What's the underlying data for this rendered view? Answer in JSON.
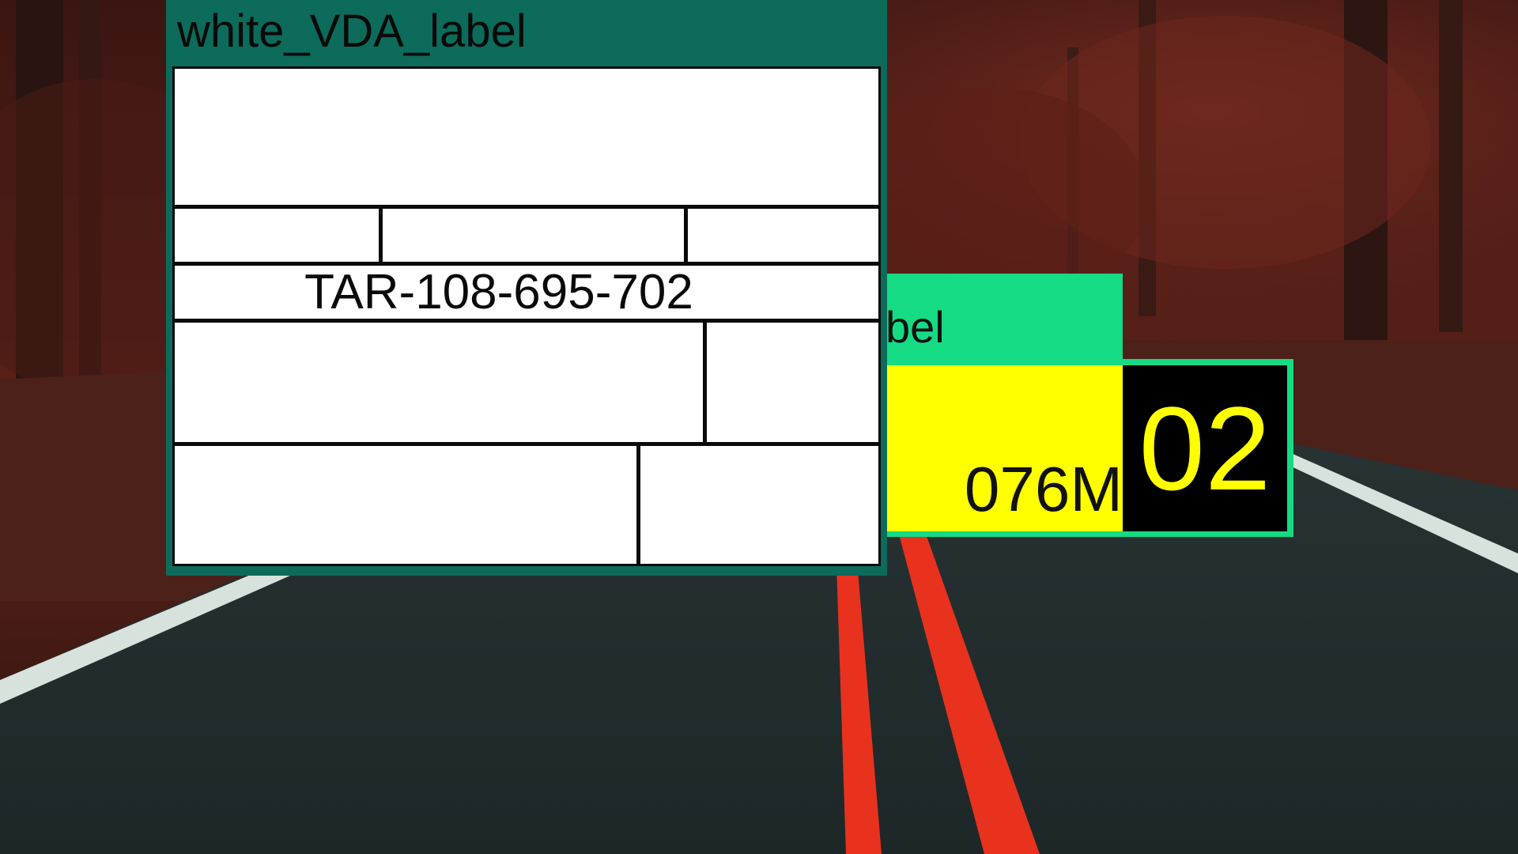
{
  "white_label": {
    "title": "white_VDA_label",
    "part_number": "TAR-108-695-702"
  },
  "yellow_label": {
    "title_fragment": "bel",
    "code_fragment": "076M",
    "number": "02"
  },
  "colors": {
    "white_label_frame": "#0c6b5a",
    "yellow_label_frame": "#14db84",
    "yellow_fill": "#ffff00",
    "black_box": "#000000",
    "road_line": "#e8321e"
  },
  "icons": {
    "background": "forest-road-photo"
  }
}
